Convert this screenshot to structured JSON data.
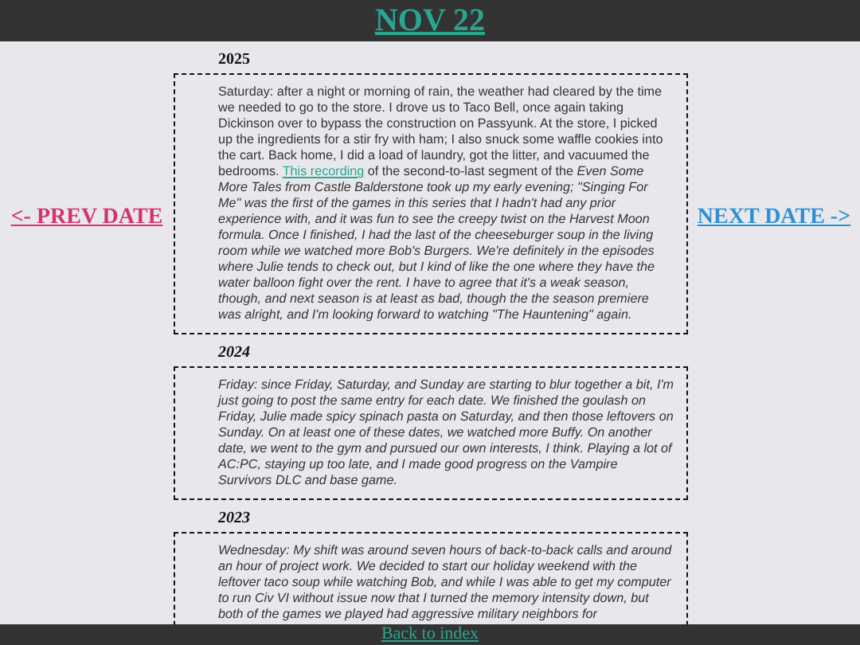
{
  "header": {
    "title": "NOV 22"
  },
  "nav": {
    "prev": "<- PREV DATE",
    "next": "NEXT DATE ->"
  },
  "entries": [
    {
      "year": "2025",
      "italic": false,
      "before": "Saturday: after a night or morning of rain, the weather had cleared by the time we needed to go to the store. I drove us to Taco Bell, once again taking Dickinson over to bypass the construction on Passyunk. At the store, I picked up the ingredients for a stir fry with ham; I also snuck some waffle cookies into the cart. Back home, I did a load of laundry, got the litter, and vacuumed the bedrooms.",
      "link": "This recording",
      "after": "of the second-to-last segment of the *Even Some More Tales from Castle Balderstone took up my early evening; \"Singing For Me\" was the first of the games in this series that I hadn't had any prior experience with, and it was fun to see the creepy twist on the Harvest Moon formula. Once I finished, I had the last of the cheeseburger soup in the living room while we watched more Bob's Burgers. We're definitely in the episodes where Julie tends to check out, but I kind of like the one where they have the water balloon fight over the rent. I have to agree that it's a weak season, though, and next season is at least as bad, though the the season premiere was alright, and I'm looking forward to watching \"The Hauntening\" again.*"
    },
    {
      "year": "2024",
      "italic": true,
      "before": "Friday: since Friday, Saturday, and Sunday are starting to blur together a bit, I'm just going to post the same entry for each date. We finished the goulash on Friday, Julie made spicy spinach pasta on Saturday, and then those leftovers on Sunday. On at least one of these dates, we watched more Buffy. On another date, we went to the gym and pursued our own interests, I think. Playing a lot of AC:PC, staying up too late, and I made good progress on the Vampire Survivors DLC and base game."
    },
    {
      "year": "2023",
      "italic": true,
      "before": "Wednesday: My shift was around seven hours of back-to-back calls and around an hour of project work. We decided to start our holiday weekend with the leftover taco soup while watching Bob, and while I was able to get my computer to run Civ VI without issue now that I turned the memory intensity down, but both of the games we played had aggressive military neighbors for"
    }
  ],
  "footer": {
    "link": "Back to index"
  }
}
